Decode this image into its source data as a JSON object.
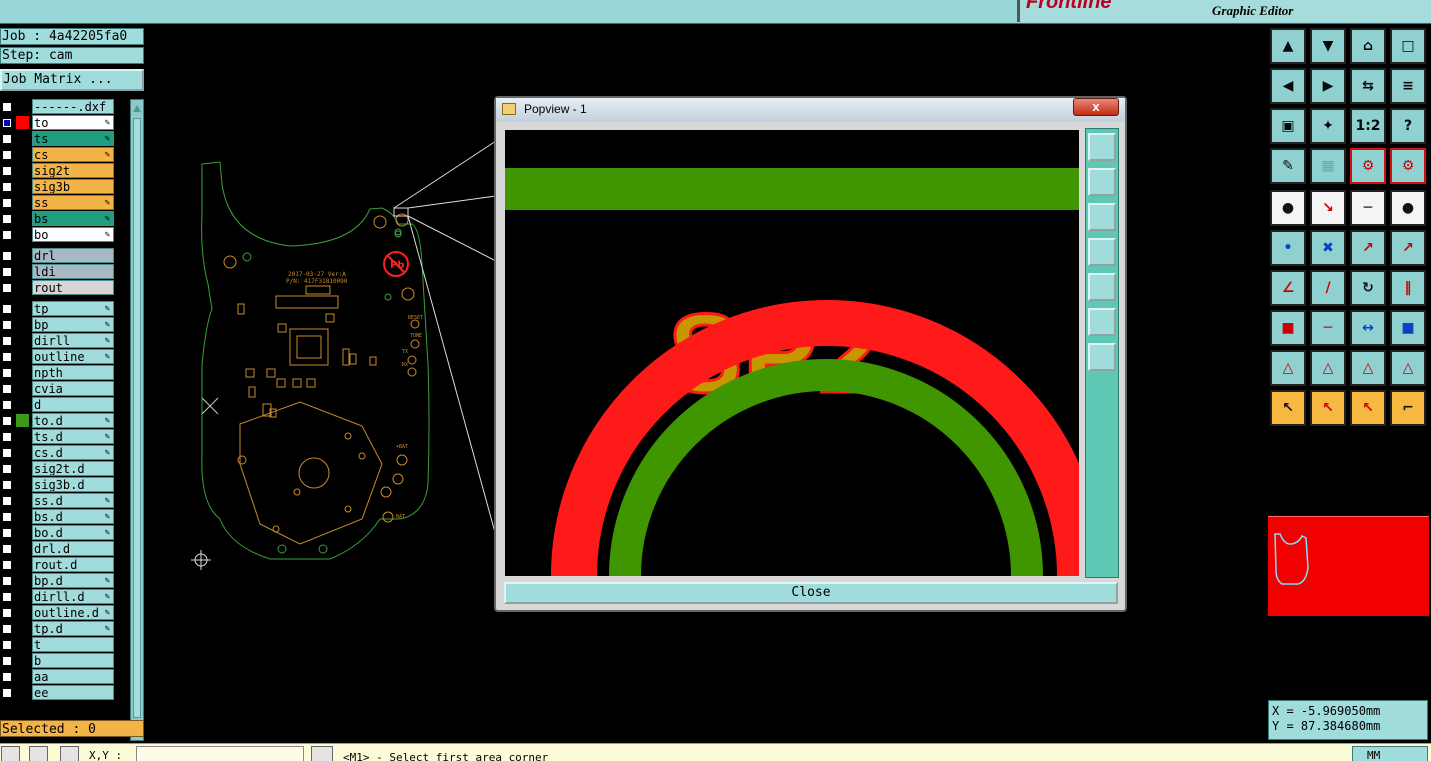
{
  "window": {
    "brand": "Frontline",
    "subtitle": "Graphic Editor"
  },
  "job": {
    "job_line": "Job : 4a42205fa0",
    "step_line": "Step: cam",
    "matrix_button": "Job Matrix ..."
  },
  "layers": [
    {
      "name": "------.dxf",
      "color": "#a0dcdc",
      "checked": false,
      "swatch": "",
      "pen": false
    },
    {
      "name": "to",
      "color": "#ffffff",
      "checked": true,
      "swatch": "#ff0000",
      "pen": true
    },
    {
      "name": "ts",
      "color": "#1f9f7f",
      "checked": false,
      "swatch": "",
      "pen": true
    },
    {
      "name": "cs",
      "color": "#f2b347",
      "checked": false,
      "swatch": "",
      "pen": true
    },
    {
      "name": "sig2t",
      "color": "#f2b347",
      "checked": false,
      "swatch": "",
      "pen": false
    },
    {
      "name": "sig3b",
      "color": "#f2b347",
      "checked": false,
      "swatch": "",
      "pen": false
    },
    {
      "name": "ss",
      "color": "#f2b347",
      "checked": false,
      "swatch": "",
      "pen": true
    },
    {
      "name": "bs",
      "color": "#1f9f7f",
      "checked": false,
      "swatch": "",
      "pen": true
    },
    {
      "name": "bo",
      "color": "#ffffff",
      "checked": false,
      "swatch": "",
      "pen": true
    },
    {
      "name": "drl",
      "color": "#a9b9c3",
      "checked": false,
      "swatch": "",
      "pen": false
    },
    {
      "name": "ldi",
      "color": "#a9b9c3",
      "checked": false,
      "swatch": "",
      "pen": false
    },
    {
      "name": "rout",
      "color": "#d6d6d6",
      "checked": false,
      "swatch": "",
      "pen": false
    },
    {
      "name": "tp",
      "color": "#a0dcdc",
      "checked": false,
      "swatch": "",
      "pen": true
    },
    {
      "name": "bp",
      "color": "#a0dcdc",
      "checked": false,
      "swatch": "",
      "pen": true
    },
    {
      "name": "dirll",
      "color": "#a0dcdc",
      "checked": false,
      "swatch": "",
      "pen": true
    },
    {
      "name": "outline",
      "color": "#a0dcdc",
      "checked": false,
      "swatch": "",
      "pen": true
    },
    {
      "name": "npth",
      "color": "#a0dcdc",
      "checked": false,
      "swatch": "",
      "pen": false
    },
    {
      "name": "cvia",
      "color": "#a0dcdc",
      "checked": false,
      "swatch": "",
      "pen": false
    },
    {
      "name": "d",
      "color": "#a0dcdc",
      "checked": false,
      "swatch": "",
      "pen": false
    },
    {
      "name": "to.d",
      "color": "#a0dcdc",
      "checked": false,
      "swatch": "#3a9a1a",
      "pen": true
    },
    {
      "name": "ts.d",
      "color": "#a0dcdc",
      "checked": false,
      "swatch": "",
      "pen": true
    },
    {
      "name": "cs.d",
      "color": "#a0dcdc",
      "checked": false,
      "swatch": "",
      "pen": true
    },
    {
      "name": "sig2t.d",
      "color": "#a0dcdc",
      "checked": false,
      "swatch": "",
      "pen": false
    },
    {
      "name": "sig3b.d",
      "color": "#a0dcdc",
      "checked": false,
      "swatch": "",
      "pen": false
    },
    {
      "name": "ss.d",
      "color": "#a0dcdc",
      "checked": false,
      "swatch": "",
      "pen": true
    },
    {
      "name": "bs.d",
      "color": "#a0dcdc",
      "checked": false,
      "swatch": "",
      "pen": true
    },
    {
      "name": "bo.d",
      "color": "#a0dcdc",
      "checked": false,
      "swatch": "",
      "pen": true
    },
    {
      "name": "drl.d",
      "color": "#a0dcdc",
      "checked": false,
      "swatch": "",
      "pen": false
    },
    {
      "name": "rout.d",
      "color": "#a0dcdc",
      "checked": false,
      "swatch": "",
      "pen": false
    },
    {
      "name": "bp.d",
      "color": "#a0dcdc",
      "checked": false,
      "swatch": "",
      "pen": true
    },
    {
      "name": "dirll.d",
      "color": "#a0dcdc",
      "checked": false,
      "swatch": "",
      "pen": true
    },
    {
      "name": "outline.d",
      "color": "#a0dcdc",
      "checked": false,
      "swatch": "",
      "pen": true
    },
    {
      "name": "tp.d",
      "color": "#a0dcdc",
      "checked": false,
      "swatch": "",
      "pen": true
    },
    {
      "name": "t",
      "color": "#a0dcdc",
      "checked": false,
      "swatch": "",
      "pen": false
    },
    {
      "name": "b",
      "color": "#a0dcdc",
      "checked": false,
      "swatch": "",
      "pen": false
    },
    {
      "name": "aa",
      "color": "#a0dcdc",
      "checked": false,
      "swatch": "",
      "pen": false
    },
    {
      "name": "ee",
      "color": "#a0dcdc",
      "checked": false,
      "swatch": "",
      "pen": false
    }
  ],
  "selected": "Selected : 0",
  "board": {
    "silk_line1": "2017-03-27 Ver:A",
    "silk_line2": "P/N: 417F31810090",
    "reset": "RESET",
    "tone": "TONE",
    "tx": "TX",
    "rx": "RX",
    "bat": "+BAT",
    "bot": "BAT",
    "pb": "Pb"
  },
  "popview": {
    "title": "Popview - 1",
    "close_x": "x",
    "close_button": "Close",
    "text": "SP2"
  },
  "coords": {
    "x": "X  =  -5.969050mm",
    "y": "Y  =  87.384680mm"
  },
  "status": {
    "xy_label": "X,Y :",
    "message": "<M1> - Select first area corner",
    "units": "MM"
  },
  "icons": [
    "copy-up-icon",
    "copy-down-icon",
    "home-icon",
    "window-icon",
    "pan-left-icon",
    "pan-right-icon",
    "zoom-1to1-icon",
    "snap-icon",
    "fit-icon",
    "zoom-in-icon",
    "ratio-icon",
    "help-icon",
    "palette-icon",
    "grid-icon",
    "highlight-icon",
    "layers-icon",
    "pad-icon",
    "line-icon",
    "ruler-icon",
    "circle-icon",
    "connect-icon",
    "cross-icon",
    "move-icon",
    "arrow-icon",
    "angle-icon",
    "slash-icon",
    "rotate-icon",
    "mirror-icon",
    "add-pad-icon",
    "minus-icon",
    "resize-icon",
    "group-icon",
    "triangle-icon",
    "triangle-up-icon",
    "triangle-red-icon",
    "triangle-mid-icon",
    "pointer-icon",
    "select-box-icon",
    "select-diamond-icon",
    "route-icon"
  ],
  "ratio_label": "1:2"
}
